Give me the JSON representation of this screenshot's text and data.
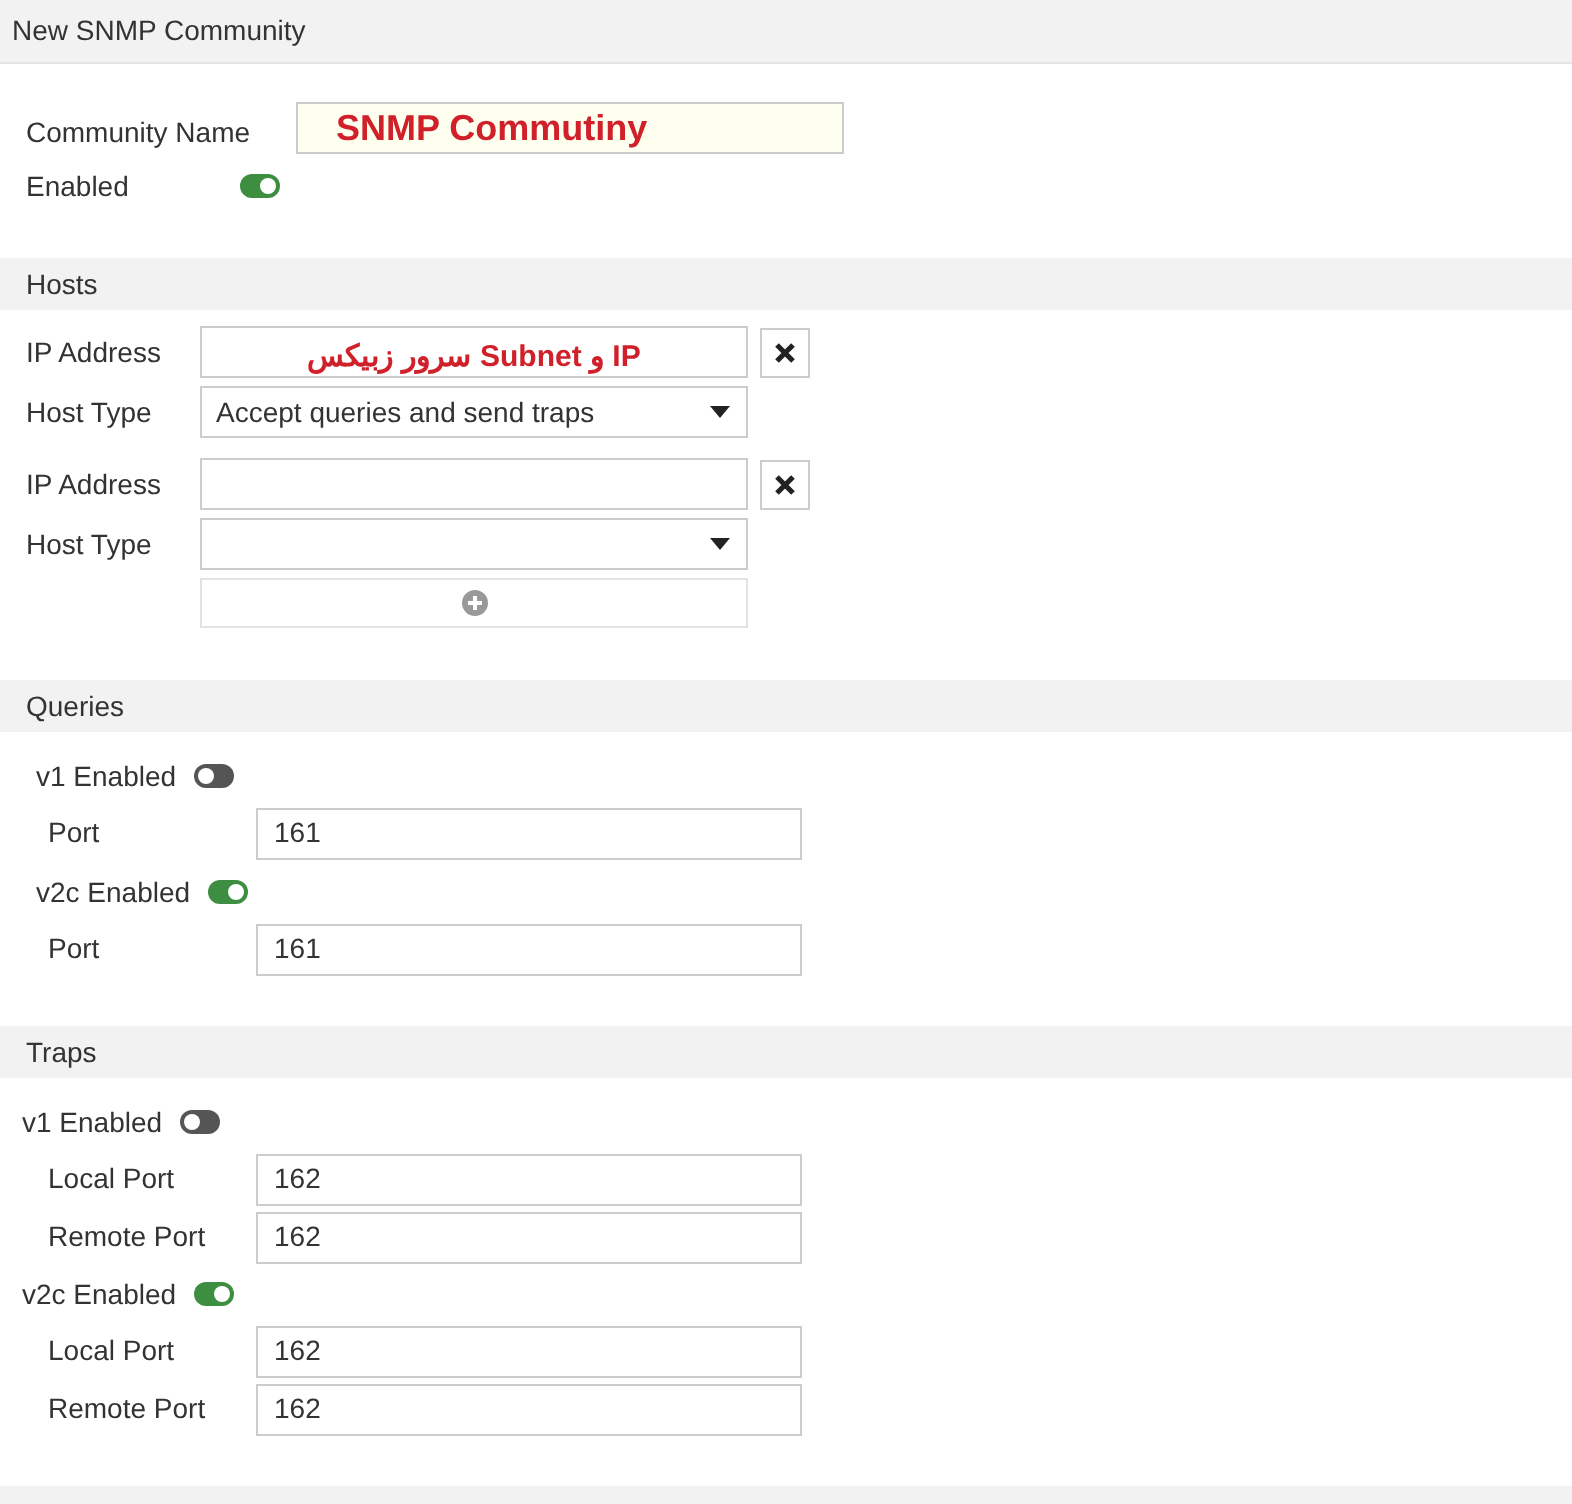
{
  "title": "New SNMP Community",
  "community": {
    "name_label": "Community Name",
    "name_value": "SNMP Commutiny",
    "enabled_label": "Enabled",
    "enabled_on": true
  },
  "hosts": {
    "heading": "Hosts",
    "entries": [
      {
        "ip_label": "IP Address",
        "ip_value": "IP و Subnet سرور زبیکس",
        "type_label": "Host Type",
        "type_value": "Accept queries and send traps"
      },
      {
        "ip_label": "IP Address",
        "type_label": "Host Type"
      }
    ]
  },
  "queries": {
    "heading": "Queries",
    "versions": [
      {
        "label": "v1 Enabled",
        "on": false,
        "ports": [
          {
            "label": "Port",
            "value": "161"
          }
        ]
      },
      {
        "label": "v2c Enabled",
        "on": true,
        "ports": [
          {
            "label": "Port",
            "value": "161"
          }
        ]
      }
    ]
  },
  "traps": {
    "heading": "Traps",
    "versions": [
      {
        "label": "v1 Enabled",
        "on": false,
        "ports": [
          {
            "label": "Local Port",
            "value": "162"
          },
          {
            "label": "Remote Port",
            "value": "162"
          }
        ]
      },
      {
        "label": "v2c Enabled",
        "on": true,
        "ports": [
          {
            "label": "Local Port",
            "value": "162"
          },
          {
            "label": "Remote Port",
            "value": "162"
          }
        ]
      }
    ]
  }
}
